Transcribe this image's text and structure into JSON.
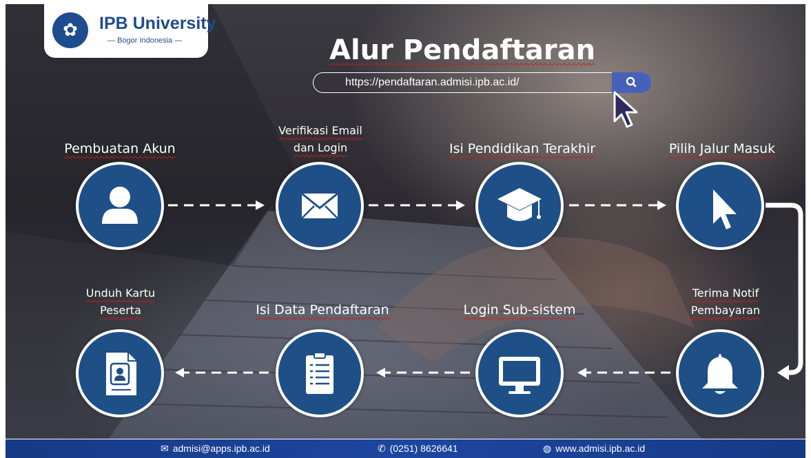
{
  "logo": {
    "name": "IPB University",
    "tagline": "Bogor Indonesia"
  },
  "title": "Alur Pendaftaran",
  "url_bar": {
    "url": "https://pendaftaran.admisi.ipb.ac.id/"
  },
  "steps": [
    {
      "lines": [
        "Pembuatan Akun"
      ],
      "icon": "user-icon"
    },
    {
      "lines": [
        "Verifikasi Email",
        "dan Login"
      ],
      "icon": "envelope-icon"
    },
    {
      "lines": [
        "Isi Pendidikan Terakhir"
      ],
      "icon": "graduation-cap-icon"
    },
    {
      "lines": [
        "Pilih Jalur Masuk"
      ],
      "icon": "cursor-icon"
    },
    {
      "lines": [
        "Terima Notif",
        "Pembayaran"
      ],
      "icon": "bell-icon"
    },
    {
      "lines": [
        "Login Sub-sistem"
      ],
      "icon": "monitor-icon"
    },
    {
      "lines": [
        "Isi Data Pendaftaran"
      ],
      "icon": "clipboard-icon"
    },
    {
      "lines": [
        "Unduh Kartu",
        "Peserta"
      ],
      "icon": "id-card-icon"
    }
  ],
  "footer": {
    "email": "admisi@apps.ipb.ac.id",
    "phone": "(0251) 8626641",
    "website": "www.admisi.ipb.ac.id"
  },
  "colors": {
    "circle_fill": "#1e4f86",
    "footer": "#1d46a0",
    "search_button": "#4662b8",
    "spell_underline": "#c81d1d"
  }
}
